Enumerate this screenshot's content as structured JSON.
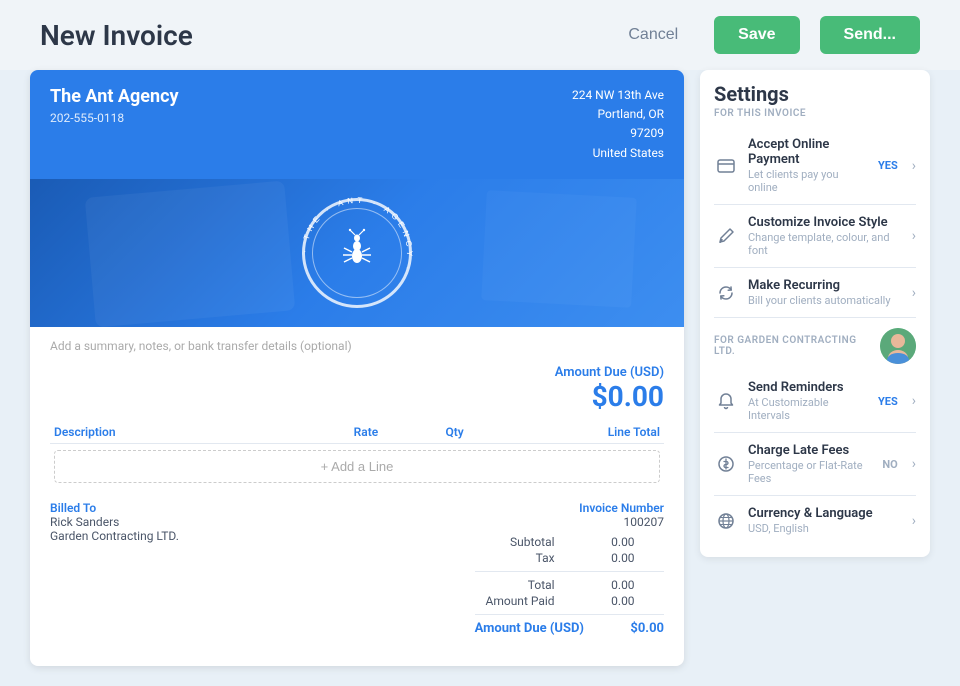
{
  "header": {
    "title": "New Invoice",
    "cancel_label": "Cancel",
    "save_label": "Save",
    "send_label": "Send..."
  },
  "invoice": {
    "company_name": "The Ant Agency",
    "phone": "202-555-0118",
    "address_line1": "224 NW 13th Ave",
    "address_line2": "Portland, OR",
    "address_line3": "97209",
    "address_line4": "United States",
    "notes_placeholder": "Add a summary, notes, or bank transfer details (optional)",
    "amount_due_label": "Amount Due (USD)",
    "amount_due_value": "$0.00",
    "table": {
      "col_description": "Description",
      "col_rate": "Rate",
      "col_qty": "Qty",
      "col_line_total": "Line Total",
      "add_line": "+ Add a Line"
    },
    "billed_to_label": "Billed To",
    "billed_to_name": "Rick Sanders",
    "billed_to_company": "Garden Contracting LTD.",
    "invoice_number_label": "Invoice Number",
    "invoice_number_value": "100207",
    "subtotal_label": "Subtotal",
    "subtotal_value": "0.00",
    "tax_label": "Tax",
    "tax_value": "0.00",
    "total_label": "Total",
    "total_value": "0.00",
    "amount_paid_label": "Amount Paid",
    "amount_paid_value": "0.00",
    "amount_due_bottom_label": "Amount Due (USD)",
    "amount_due_bottom_value": "$0.00"
  },
  "settings": {
    "title": "Settings",
    "subtitle": "FOR THIS INVOICE",
    "items": [
      {
        "id": "online-payment",
        "label": "Accept Online Payment",
        "desc": "Let clients pay you online",
        "badge": "YES",
        "has_badge": true,
        "icon": "card"
      },
      {
        "id": "customize-style",
        "label": "Customize Invoice Style",
        "desc": "Change template, colour, and font",
        "badge": "",
        "has_badge": false,
        "icon": "brush"
      },
      {
        "id": "make-recurring",
        "label": "Make Recurring",
        "desc": "Bill your clients automatically",
        "badge": "",
        "has_badge": false,
        "icon": "refresh"
      }
    ],
    "subtitle2": "FOR GARDEN CONTRACTING LTD.",
    "items2": [
      {
        "id": "send-reminders",
        "label": "Send Reminders",
        "desc": "At Customizable Intervals",
        "badge": "YES",
        "has_badge": true,
        "icon": "bell"
      },
      {
        "id": "charge-late-fees",
        "label": "Charge Late Fees",
        "desc": "Percentage or Flat-Rate Fees",
        "badge": "NO",
        "has_badge": true,
        "icon": "dollar"
      },
      {
        "id": "currency-language",
        "label": "Currency & Language",
        "desc": "USD, English",
        "badge": "",
        "has_badge": false,
        "icon": "globe"
      }
    ]
  }
}
